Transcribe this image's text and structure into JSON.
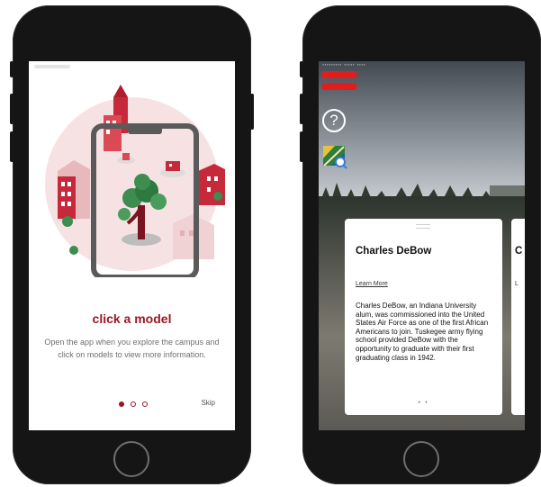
{
  "onboarding": {
    "title": "click a model",
    "description": "Open the app when you explore the campus and click on models to view more information.",
    "skip_label": "Skip",
    "pagination": {
      "current": 1,
      "total": 3
    }
  },
  "ar_view": {
    "help_icon_glyph": "?",
    "card": {
      "title": "Charles DeBow",
      "link": "Learn More",
      "body": "Charles DeBow, an Indiana University alum, was commissioned into the United States Air Force as one of the first African Americans to join.  Tuskegee army flying school provided DeBow with the opportunity to graduate with their first graduating class in 1942.",
      "pager": "• •"
    },
    "next_card": {
      "title_fragment": "C",
      "line_fragment": "L"
    }
  },
  "colors": {
    "accent": "#9b1720",
    "alert_red": "#e01e1e",
    "phone_body": "#151515"
  },
  "icons": [
    "question-mark-icon",
    "map-icon",
    "home-button"
  ]
}
